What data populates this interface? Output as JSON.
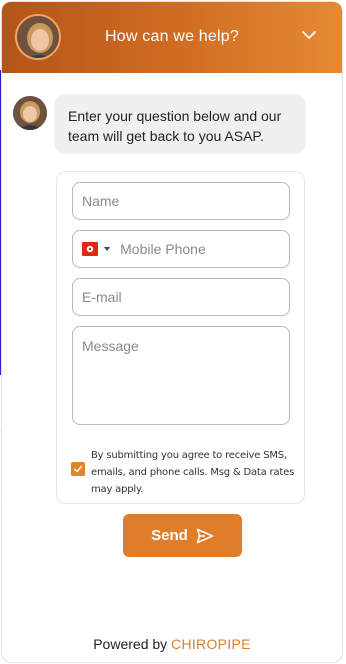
{
  "header": {
    "title": "How can we help?",
    "icons": {
      "avatar": "agent-avatar",
      "collapse": "chevron-down-icon"
    }
  },
  "message": {
    "text": "Enter your question below and our team will get back to you ASAP."
  },
  "form": {
    "name_placeholder": "Name",
    "phone_placeholder": "Mobile Phone",
    "phone_country_flag": "hong-kong-flag-icon",
    "email_placeholder": "E-mail",
    "message_placeholder": "Message",
    "consent_checked": true,
    "consent_text": "By submitting you agree to receive SMS, emails, and phone calls. Msg & Data rates may apply.",
    "send_label": "Send"
  },
  "footer": {
    "powered_by": "Powered by",
    "brand": "CHIROPIPE"
  },
  "colors": {
    "accent": "#e07d2a",
    "header_start": "#b35518",
    "header_end": "#e58a33"
  }
}
